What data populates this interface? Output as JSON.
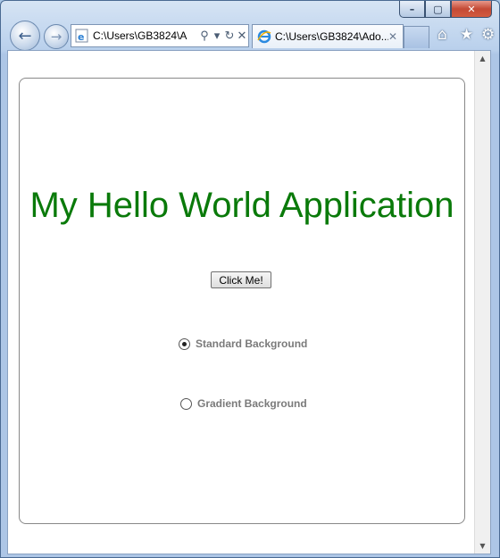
{
  "browser": {
    "address_text": "C:\\Users\\GB3824\\A",
    "tab_title": "C:\\Users\\GB3824\\Ado...",
    "caption": {
      "minimize": "–",
      "maximize": "▢",
      "close": "✕"
    }
  },
  "app": {
    "title": "My Hello World Application",
    "button_label": "Click Me!",
    "radios": [
      {
        "label": "Standard Background",
        "selected": true
      },
      {
        "label": "Gradient Background",
        "selected": false
      }
    ]
  }
}
